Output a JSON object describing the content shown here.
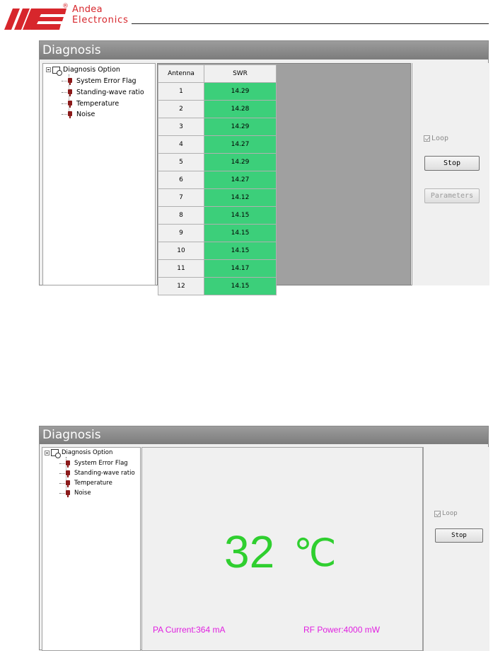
{
  "header": {
    "company_line1": "Andea",
    "company_line2": "Electronics",
    "registered_mark": "®",
    "brand_color": "#d7262c"
  },
  "panel1": {
    "title": "Diagnosis",
    "tree": {
      "root": "Diagnosis Option",
      "items": [
        "System Error Flag",
        "Standing-wave ratio",
        "Temperature",
        "Noise"
      ]
    },
    "table": {
      "headers": [
        "Antenna",
        "SWR"
      ],
      "rows": [
        [
          "1",
          "14.29"
        ],
        [
          "2",
          "14.28"
        ],
        [
          "3",
          "14.29"
        ],
        [
          "4",
          "14.27"
        ],
        [
          "5",
          "14.29"
        ],
        [
          "6",
          "14.27"
        ],
        [
          "7",
          "14.12"
        ],
        [
          "8",
          "14.15"
        ],
        [
          "9",
          "14.15"
        ],
        [
          "10",
          "14.15"
        ],
        [
          "11",
          "14.17"
        ],
        [
          "12",
          "14.15"
        ]
      ],
      "swr_cell_color": "#3ccf7a"
    },
    "loop_label": "Loop",
    "loop_checked": true,
    "stop_label": "Stop",
    "parameters_label": "Parameters"
  },
  "panel2": {
    "title": "Diagnosis",
    "tree": {
      "root": "Diagnosis Option",
      "items": [
        "System Error Flag",
        "Standing-wave ratio",
        "Temperature",
        "Noise"
      ]
    },
    "temperature_value": "32",
    "temperature_unit": "℃",
    "temperature_color": "#2fcf2f",
    "pa_current": "PA Current:364 mA",
    "rf_power": "RF Power:4000 mW",
    "info_color": "#e020e0",
    "loop_label": "Loop",
    "loop_checked": true,
    "stop_label": "Stop"
  }
}
